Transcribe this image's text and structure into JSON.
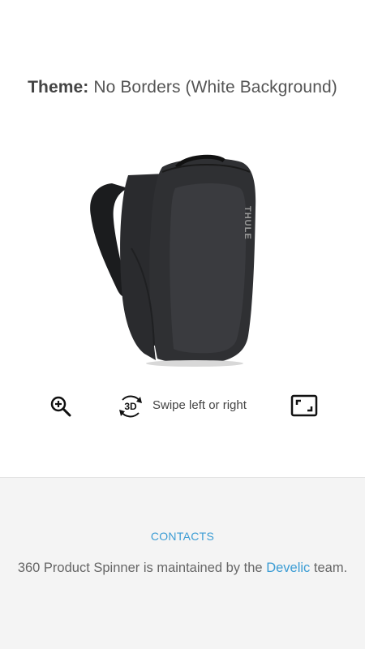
{
  "theme": {
    "label": "Theme:",
    "value": "No Borders (White Background)"
  },
  "product": {
    "brand_mark": "THULE"
  },
  "controls": {
    "zoom_icon": "zoom-in-icon",
    "rotate_icon": "rotate-3d-icon",
    "rotate_icon_text": "3D",
    "hint": "Swipe left or right",
    "fullscreen_icon": "fullscreen-icon"
  },
  "footer": {
    "contacts_label": "CONTACTS",
    "maintained_prefix": "360 Product Spinner is maintained by the",
    "team_link": "Develic",
    "maintained_suffix": "team."
  },
  "colors": {
    "link": "#3b9cd4",
    "footer_bg": "#f4f4f4",
    "text": "#666666"
  }
}
